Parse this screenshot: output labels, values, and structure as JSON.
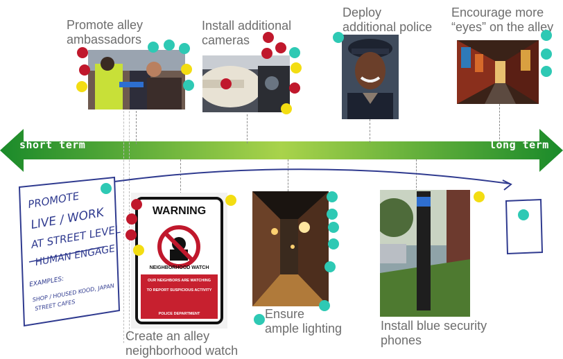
{
  "timeline": {
    "start_label": "short term",
    "end_label": "long term",
    "colors": {
      "dark": "#1a8a2a",
      "light": "#a9d34b"
    }
  },
  "items_top": [
    {
      "line1": "Promote alley",
      "line2": "ambassadors",
      "image": "security-guard-with-crowd-photo"
    },
    {
      "line1": "Install additional",
      "line2": "cameras",
      "image": "security-camera-photo"
    },
    {
      "line1": "Deploy",
      "line2": "additional police",
      "image": "police-officer-photo"
    },
    {
      "line1": "Encourage more",
      "line2": "“eyes” on the alley",
      "image": "alley-storefronts-photo"
    }
  ],
  "items_bottom": [
    {
      "line1": "Create an alley",
      "line2": "neighborhood watch",
      "image": "neighborhood-watch-sign-photo"
    },
    {
      "line1": "Ensure",
      "line2": "ample lighting",
      "image": "lit-alley-at-night-photo"
    },
    {
      "line1": "Install blue security",
      "line2": "phones",
      "image": "blue-light-phone-pole-photo"
    }
  ],
  "sign": {
    "title": "WARNING",
    "subtitle": "NEIGHBORHOOD WATCH",
    "line1": "OUR NEIGHBORS ARE WATCHING",
    "line2": "TO REPORT SUSPICIOUS ACTIVITY",
    "line3": "POLICE DEPARTMENT"
  },
  "handwritten_note": {
    "lines": [
      "PROMOTE",
      "LIVE / WORK",
      "AT STREET LEVEL",
      "HUMAN ENGAGE",
      "EXAMPLES:",
      "SHOP / HOUSED KOOD, JAPAN",
      "STREET CAFES"
    ]
  },
  "dot_colors": {
    "red": "#c0182c",
    "teal": "#2ec9b4",
    "yellow": "#f3dd12"
  }
}
